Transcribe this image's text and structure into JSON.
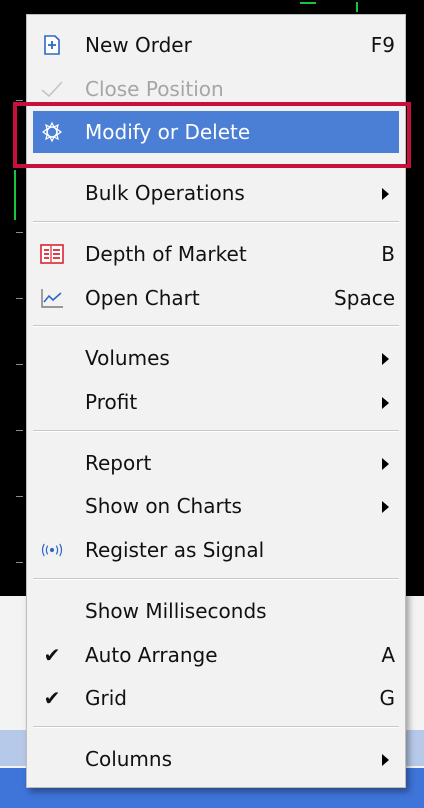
{
  "menu": {
    "items": [
      {
        "id": "new-order",
        "label": "New Order",
        "shortcut": "F9",
        "icon": "plus-box-icon"
      },
      {
        "id": "close-position",
        "label": "Close Position",
        "shortcut": "",
        "icon": "check-icon",
        "disabled": true
      },
      {
        "id": "modify-or-delete",
        "label": "Modify or Delete",
        "shortcut": "",
        "icon": "gear-icon",
        "highlighted": true
      },
      {
        "id": "bulk-operations",
        "label": "Bulk Operations",
        "submenu": true
      },
      {
        "id": "depth-of-market",
        "label": "Depth of Market",
        "shortcut": "B",
        "icon": "depth-of-market-icon"
      },
      {
        "id": "open-chart",
        "label": "Open Chart",
        "shortcut": "Space",
        "icon": "chart-line-icon"
      },
      {
        "id": "volumes",
        "label": "Volumes",
        "submenu": true
      },
      {
        "id": "profit",
        "label": "Profit",
        "submenu": true
      },
      {
        "id": "report",
        "label": "Report",
        "submenu": true
      },
      {
        "id": "show-on-charts",
        "label": "Show on Charts",
        "submenu": true
      },
      {
        "id": "register-as-signal",
        "label": "Register as Signal",
        "icon": "signal-broadcast-icon"
      },
      {
        "id": "show-milliseconds",
        "label": "Show Milliseconds"
      },
      {
        "id": "auto-arrange",
        "label": "Auto Arrange",
        "shortcut": "A",
        "checked": true
      },
      {
        "id": "grid",
        "label": "Grid",
        "shortcut": "G",
        "checked": true
      },
      {
        "id": "columns",
        "label": "Columns",
        "submenu": true
      }
    ],
    "check_mark": "✔",
    "colors": {
      "highlight": "#4b7fd6",
      "focus_frame": "#c8103c",
      "disabled_text": "#a6a6a6",
      "depth_icon_red": "#d9262e",
      "icon_blue": "#2f67c8"
    }
  }
}
